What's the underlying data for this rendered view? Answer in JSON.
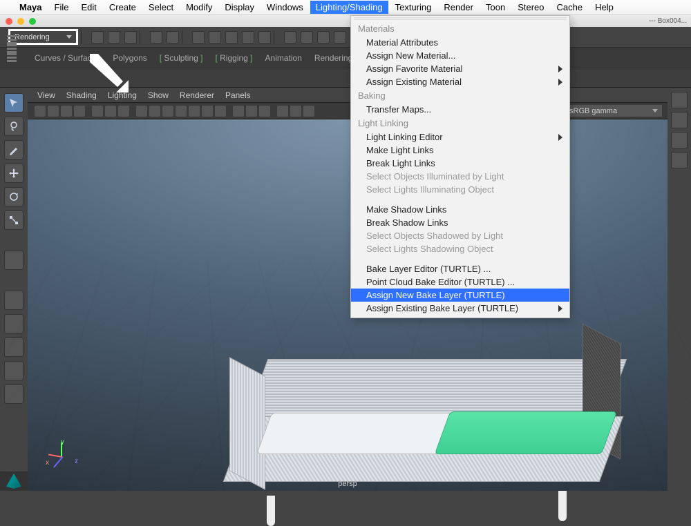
{
  "macmenu": {
    "app": "Maya",
    "items": [
      "File",
      "Edit",
      "Create",
      "Select",
      "Modify",
      "Display",
      "Windows",
      "Lighting/Shading",
      "Texturing",
      "Render",
      "Toon",
      "Stereo",
      "Cache",
      "Help"
    ],
    "highlighted": "Lighting/Shading"
  },
  "window": {
    "title": "---    Box004..."
  },
  "mode_dropdown": {
    "label": "Rendering"
  },
  "shelf_tabs": [
    "Curves / Surfaces",
    "Polygons",
    "Sculpting",
    "Rigging",
    "Animation",
    "Rendering"
  ],
  "panel_menu": [
    "View",
    "Shading",
    "Lighting",
    "Show",
    "Renderer",
    "Panels"
  ],
  "color_mgmt": {
    "label": "sRGB gamma"
  },
  "viewport": {
    "camera_label": "persp",
    "axis_labels": {
      "x": "x",
      "y": "y",
      "z": "z"
    }
  },
  "dropdown": {
    "sections": [
      {
        "header": "Materials",
        "items": [
          {
            "label": "Material Attributes"
          },
          {
            "label": "Assign New Material..."
          },
          {
            "label": "Assign Favorite Material",
            "submenu": true
          },
          {
            "label": "Assign Existing Material",
            "submenu": true
          }
        ]
      },
      {
        "header": "Baking",
        "items": [
          {
            "label": "Transfer Maps..."
          }
        ]
      },
      {
        "header": "Light Linking",
        "items": [
          {
            "label": "Light Linking Editor",
            "submenu": true
          },
          {
            "label": "Make Light Links"
          },
          {
            "label": "Break Light Links"
          },
          {
            "label": "Select Objects Illuminated by Light",
            "disabled": true
          },
          {
            "label": "Select Lights Illuminating Object",
            "disabled": true
          }
        ]
      },
      {
        "header": "",
        "items": [
          {
            "label": "Make Shadow Links"
          },
          {
            "label": "Break Shadow Links"
          },
          {
            "label": "Select Objects Shadowed by Light",
            "disabled": true
          },
          {
            "label": "Select Lights Shadowing Object",
            "disabled": true
          }
        ]
      },
      {
        "header": "",
        "items": [
          {
            "label": "Bake Layer Editor (TURTLE) ..."
          },
          {
            "label": "Point Cloud Bake Editor (TURTLE) ..."
          },
          {
            "label": "Assign New Bake Layer (TURTLE)",
            "highlight": true
          },
          {
            "label": "Assign Existing Bake Layer (TURTLE)",
            "submenu": true
          }
        ]
      }
    ]
  }
}
